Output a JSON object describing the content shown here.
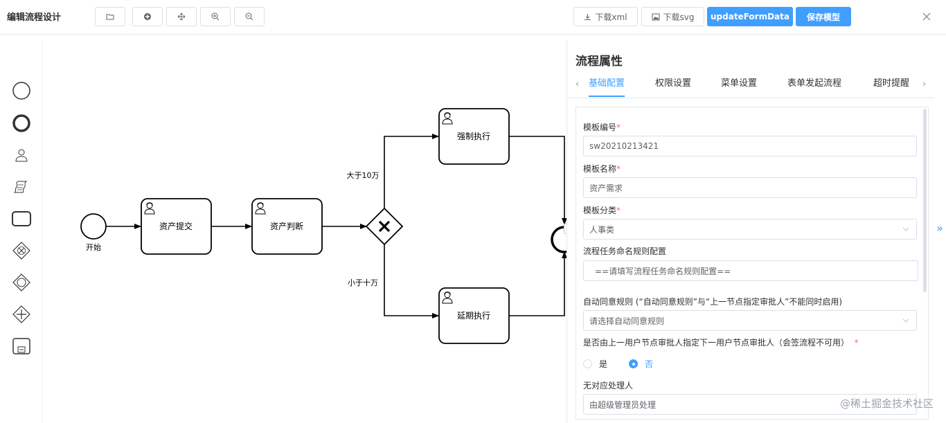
{
  "header": {
    "title": "编辑流程设计",
    "download_xml": "下载xml",
    "download_svg": "下载svg",
    "update_form": "updateFormData",
    "save_model": "保存模型"
  },
  "diagram": {
    "start_label": "开始",
    "task_submit": "资产提交",
    "task_judge": "资产判断",
    "task_force": "强制执行",
    "task_delay": "延期执行",
    "flow_gt": "大于10万",
    "flow_lt": "小于十万"
  },
  "panel": {
    "title": "流程属性",
    "tabs": [
      "基础配置",
      "权限设置",
      "菜单设置",
      "表单发起流程",
      "超时提醒"
    ],
    "fields": {
      "tpl_code_label": "模板编号",
      "tpl_code_value": "sw20210213421",
      "tpl_name_label": "模板名称",
      "tpl_name_value": "资产需求",
      "tpl_cat_label": "模板分类",
      "tpl_cat_value": "人事类",
      "naming_label": "流程任务命名规则配置",
      "naming_placeholder": "==请填写流程任务命名规则配置==",
      "auto_agree_label": "自动同意规则 (“自动同意规则”与“上一节点指定审批人”不能同时启用)",
      "auto_agree_placeholder": "请选择自动同意规则",
      "prev_assign_label": "是否由上一用户节点审批人指定下一用户节点审批人（会签流程不可用）",
      "radio_yes": "是",
      "radio_no": "否",
      "no_handler_label": "无对应处理人",
      "no_handler_value": "由超级管理员处理"
    },
    "required_mark": "*"
  },
  "watermark": "@稀土掘金技术社区"
}
